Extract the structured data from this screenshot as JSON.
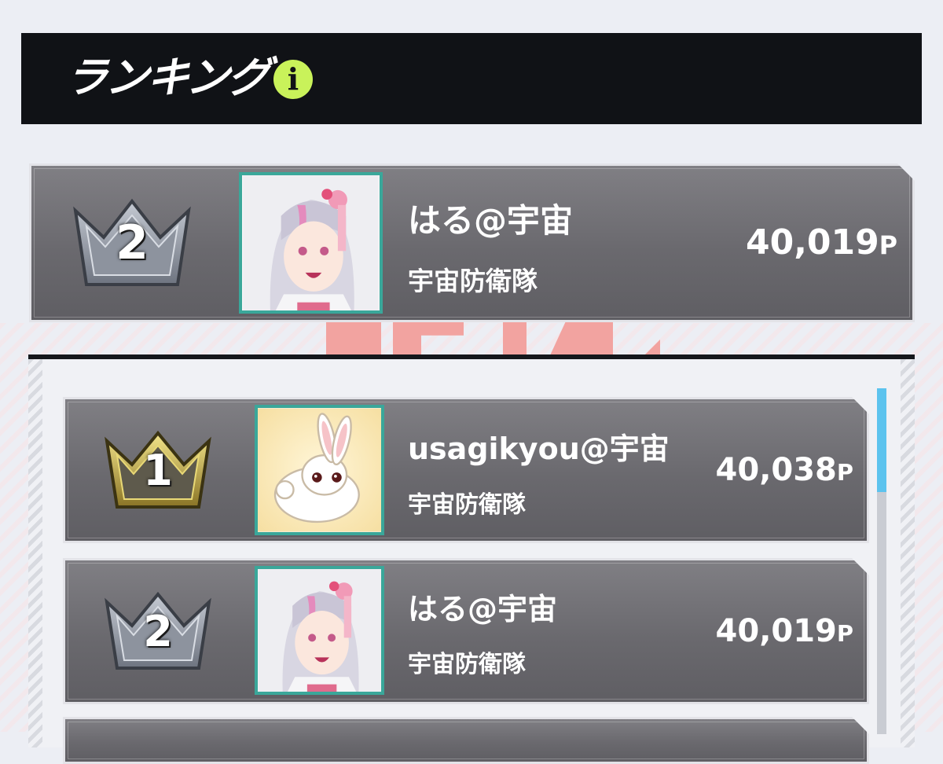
{
  "header": {
    "title": "ランキング",
    "info_icon": "i"
  },
  "my_rank": {
    "rank": "2",
    "crown": "silver-crown-icon",
    "avatar": "silver-haired-girl-avatar",
    "name": "はる@宇宙",
    "team": "宇宙防衛隊",
    "score": "40,019",
    "unit": "P"
  },
  "ranking_list": [
    {
      "rank": "1",
      "crown": "gold-crown-icon",
      "avatar": "white-rabbit-avatar",
      "name": "usagikyou@宇宙",
      "team": "宇宙防衛隊",
      "score": "40,038",
      "unit": "P"
    },
    {
      "rank": "2",
      "crown": "silver-crown-icon",
      "avatar": "silver-haired-girl-avatar",
      "name": "はる@宇宙",
      "team": "宇宙防衛隊",
      "score": "40,019",
      "unit": "P"
    }
  ],
  "colors": {
    "header_bg": "#101216",
    "info_accent": "#c9f25a",
    "card_bg": "#6f6e73",
    "avatar_border": "#3aa79a",
    "scroll_thumb": "#5cc3ee",
    "gold": "#d8c25a",
    "silver": "#9aa0aa"
  }
}
